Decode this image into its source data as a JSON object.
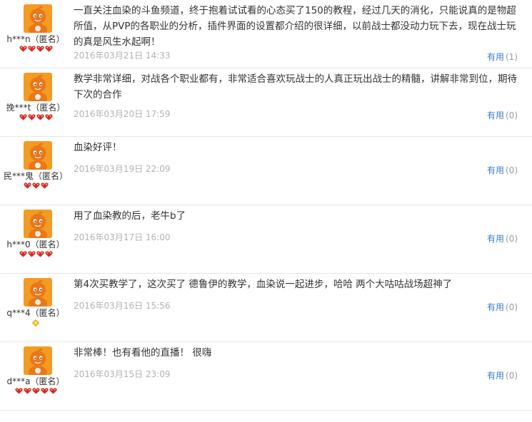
{
  "colors": {
    "accent": "#3a7ec7",
    "avatar": "#f08c1e",
    "badge": "#d9281f"
  },
  "reviews": [
    {
      "username": "h***n（匿名）",
      "text": "一直关注血染的斗鱼频道，终于抱着试试看的心态买了150的教程，经过几天的消化，只能说真的是物超所值，从PVP的各职业的分析，插件界面的设置都介绍的很详细，以前战士都没动力玩下去，现在战士玩的真是风生水起啊！",
      "date": "2016年03月21日 14:33",
      "useful_label": "有用",
      "useful_count": "(1)",
      "badge_count": 4,
      "badge_type": "heart"
    },
    {
      "username": "挽***t（匿名）",
      "text": "教学非常详细，对战各个职业都有，非常适合喜欢玩战士的人真正玩出战士的精髓，讲解非常到位，期待下次的合作",
      "date": "2016年03月20日 17:59",
      "useful_label": "有用",
      "useful_count": "(0)",
      "badge_count": 4,
      "badge_type": "heart"
    },
    {
      "username": "民***鬼（匿名）",
      "text": "血染好评！",
      "date": "2016年03月19日 22:09",
      "useful_label": "有用",
      "useful_count": "(0)",
      "badge_count": 3,
      "badge_type": "heart"
    },
    {
      "username": "h***0（匿名）",
      "text": "用了血染教的后，老牛b了",
      "date": "2016年03月17日 16:00",
      "useful_label": "有用",
      "useful_count": "(0)",
      "badge_count": 4,
      "badge_type": "heart"
    },
    {
      "username": "q***4（匿名）",
      "text": "第4次买教学了，这次买了 德鲁伊的教学，血染说一起进步，哈哈 两个大咕咕战场超神了",
      "date": "2016年03月16日 15:56",
      "useful_label": "有用",
      "useful_count": "(0)",
      "badge_count": 1,
      "badge_type": "diamond"
    },
    {
      "username": "d***a（匿名）",
      "text": "非常棒！也有看他的直播！ 很嗨",
      "date": "2016年03月15日 23:09",
      "useful_label": "有用",
      "useful_count": "(0)",
      "badge_count": 5,
      "badge_type": "heart"
    }
  ]
}
